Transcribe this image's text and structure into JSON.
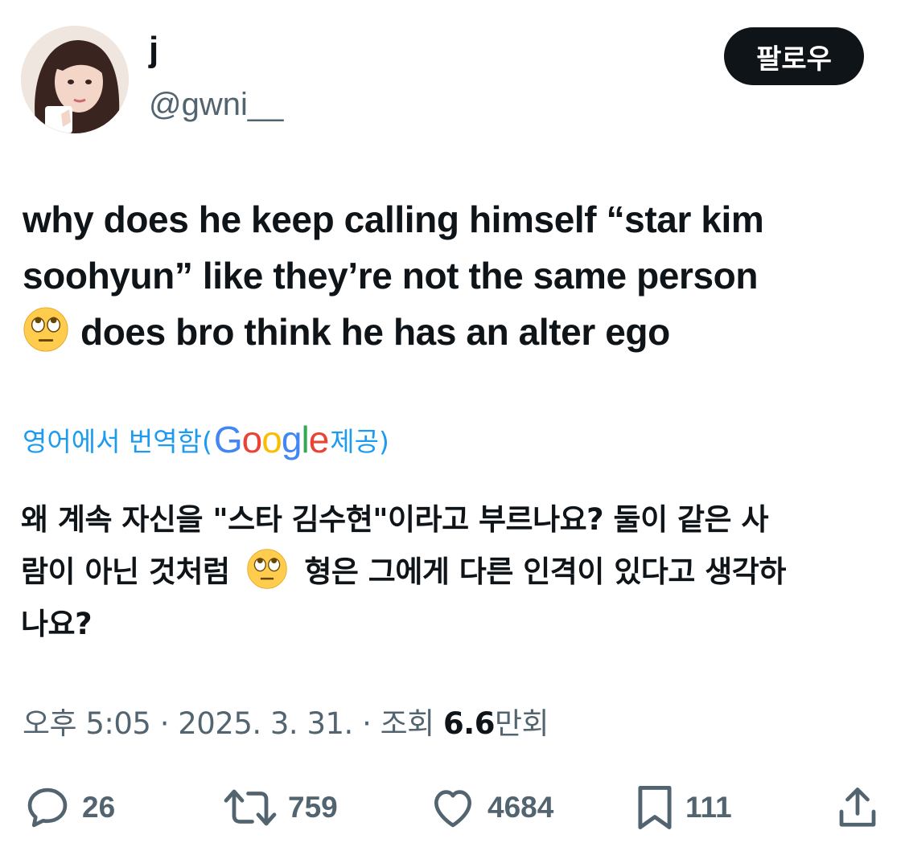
{
  "user": {
    "display_name": "j",
    "handle": "@gwni__"
  },
  "follow_button": "팔로우",
  "tweet": {
    "line1": "why does he keep calling himself “star kim",
    "line2": "soohyun” like they’re not the same person",
    "line3": "does bro think he has an alter ego",
    "emoji": "face-with-rolling-eyes"
  },
  "translation": {
    "prefix": "영어에서 번역함(",
    "google": [
      "G",
      "o",
      "o",
      "g",
      "l",
      "e"
    ],
    "suffix": " 제공)",
    "line1": "왜 계속 자신을 \"스타 김수현\"이라고 부르나요? 둘이 같은 사",
    "line2a": "람이 아닌 것처럼",
    "line2b": "형은 그에게 다른 인격이 있다고 생각하",
    "line3": "나요?"
  },
  "meta": {
    "time": "오후 5:05 · 2025. 3. 31. · 조회 ",
    "views_number": "6.6",
    "views_unit": "만회"
  },
  "actions": {
    "replies": "26",
    "retweets": "759",
    "likes": "4684",
    "bookmarks": "111"
  },
  "colors": {
    "text": "#0f1419",
    "secondary": "#536471",
    "link": "#1d9bf0"
  }
}
